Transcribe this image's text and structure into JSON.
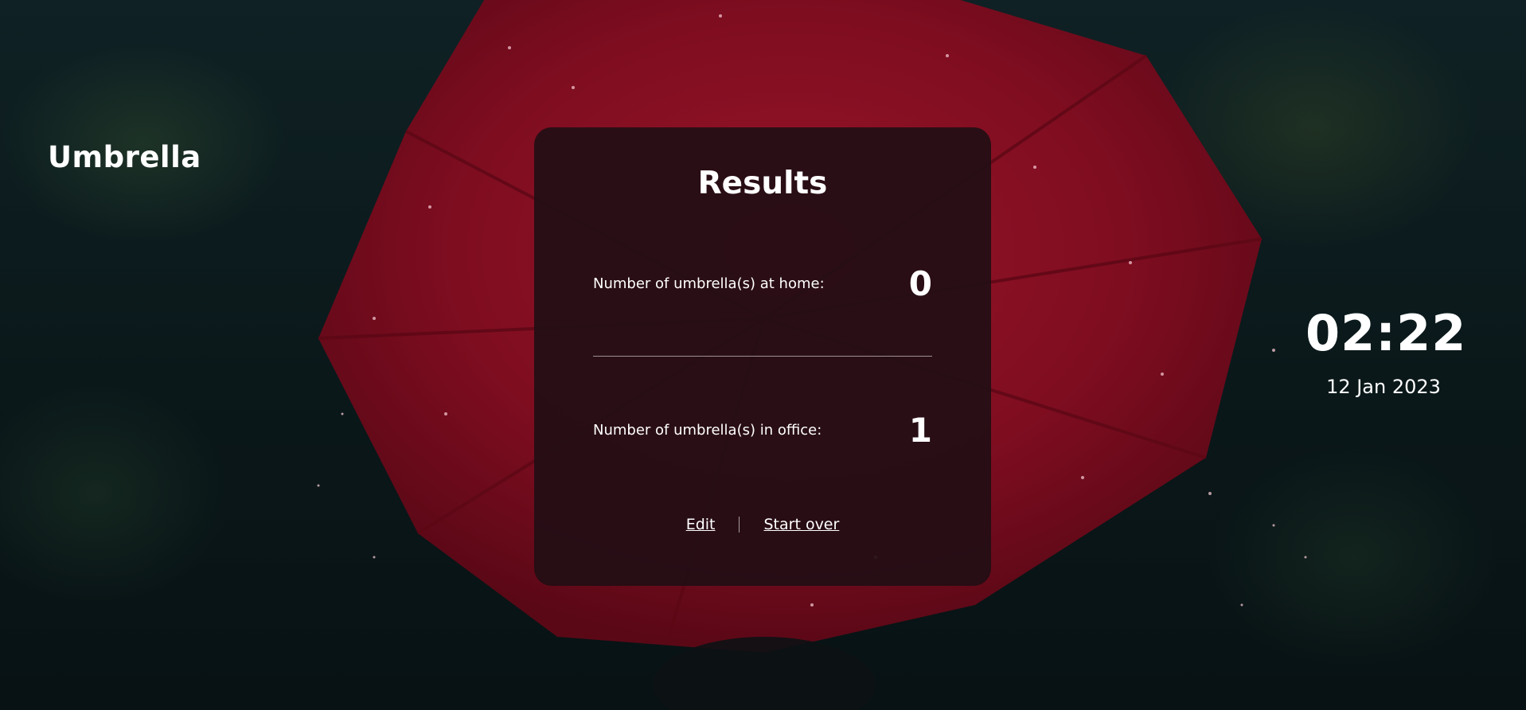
{
  "brand": {
    "title": "Umbrella"
  },
  "results": {
    "title": "Results",
    "home": {
      "label": "Number of umbrella(s) at home:",
      "value": "0"
    },
    "office": {
      "label": "Number of umbrella(s) in office:",
      "value": "1"
    },
    "actions": {
      "edit_label": "Edit",
      "start_over_label": "Start over"
    }
  },
  "clock": {
    "time": "02:22",
    "date": "12 Jan 2023"
  },
  "colors": {
    "umbrella": "#8a0f22",
    "card_background": "#220e14",
    "page_background": "#0c1a1c",
    "text": "#ffffff"
  }
}
